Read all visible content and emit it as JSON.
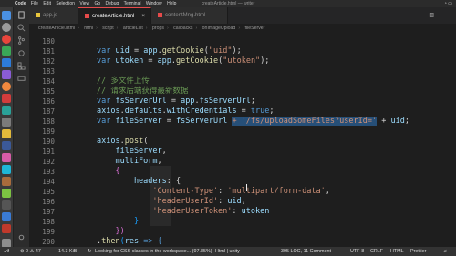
{
  "menubar": {
    "app_name": "Code",
    "items": [
      "File",
      "Edit",
      "Selection",
      "View",
      "Go",
      "Debug",
      "Terminal",
      "Window",
      "Help"
    ],
    "window_title": "createArticle.html — writer"
  },
  "tabs": [
    {
      "label": "app.js",
      "active": false
    },
    {
      "label": "createArticle.html",
      "active": true
    },
    {
      "label": "contentMng.html",
      "active": false
    }
  ],
  "breadcrumb": [
    "createArticle.html",
    "html",
    "script",
    "articleList",
    "props",
    "callbacks",
    "onImageUpload",
    "fileServer"
  ],
  "code_lines": [
    {
      "num": "180",
      "tokens": []
    },
    {
      "num": "181",
      "tokens": [
        {
          "t": "var ",
          "c": "t-kw"
        },
        {
          "t": "uid",
          "c": "t-var"
        },
        {
          "t": " = ",
          "c": "t-pl"
        },
        {
          "t": "app",
          "c": "t-var"
        },
        {
          "t": ".",
          "c": "t-pl"
        },
        {
          "t": "getCookie",
          "c": "t-fn"
        },
        {
          "t": "(",
          "c": "t-pl"
        },
        {
          "t": "\"uid\"",
          "c": "t-str"
        },
        {
          "t": ");",
          "c": "t-pl"
        }
      ]
    },
    {
      "num": "182",
      "tokens": [
        {
          "t": "var ",
          "c": "t-kw"
        },
        {
          "t": "utoken",
          "c": "t-var"
        },
        {
          "t": " = ",
          "c": "t-pl"
        },
        {
          "t": "app",
          "c": "t-var"
        },
        {
          "t": ".",
          "c": "t-pl"
        },
        {
          "t": "getCookie",
          "c": "t-fn"
        },
        {
          "t": "(",
          "c": "t-pl"
        },
        {
          "t": "\"utoken\"",
          "c": "t-str"
        },
        {
          "t": ");",
          "c": "t-pl"
        }
      ]
    },
    {
      "num": "183",
      "tokens": []
    },
    {
      "num": "184",
      "tokens": [
        {
          "t": "// 多文件上传",
          "c": "t-cm"
        }
      ]
    },
    {
      "num": "185",
      "tokens": [
        {
          "t": "// 请求后端获得最新数据",
          "c": "t-cm"
        }
      ]
    },
    {
      "num": "186",
      "tokens": [
        {
          "t": "var ",
          "c": "t-kw"
        },
        {
          "t": "fsServerUrl",
          "c": "t-var"
        },
        {
          "t": " = ",
          "c": "t-pl"
        },
        {
          "t": "app",
          "c": "t-var"
        },
        {
          "t": ".",
          "c": "t-pl"
        },
        {
          "t": "fsServerUrl",
          "c": "t-var"
        },
        {
          "t": ";",
          "c": "t-pl"
        }
      ]
    },
    {
      "num": "187",
      "tokens": [
        {
          "t": "axios",
          "c": "t-var"
        },
        {
          "t": ".",
          "c": "t-pl"
        },
        {
          "t": "defaults",
          "c": "t-var"
        },
        {
          "t": ".",
          "c": "t-pl"
        },
        {
          "t": "withCredentials",
          "c": "t-var"
        },
        {
          "t": " = ",
          "c": "t-pl"
        },
        {
          "t": "true",
          "c": "t-kw"
        },
        {
          "t": ";",
          "c": "t-pl"
        }
      ]
    },
    {
      "num": "188",
      "tokens": [
        {
          "t": "var ",
          "c": "t-kw"
        },
        {
          "t": "fileServer",
          "c": "t-var"
        },
        {
          "t": " = ",
          "c": "t-pl"
        },
        {
          "t": "fsServerUrl",
          "c": "t-var"
        },
        {
          "t": " ",
          "c": "t-pl"
        },
        {
          "t": "+ '/fs/uploadSomeFiles?userId='",
          "c": "t-str hl"
        },
        {
          "t": " + ",
          "c": "t-pl"
        },
        {
          "t": "uid",
          "c": "t-var"
        },
        {
          "t": ";",
          "c": "t-pl"
        }
      ]
    },
    {
      "num": "189",
      "tokens": []
    },
    {
      "num": "190",
      "tokens": [
        {
          "t": "axios",
          "c": "t-var"
        },
        {
          "t": ".",
          "c": "t-pl"
        },
        {
          "t": "post",
          "c": "t-fn"
        },
        {
          "t": "(",
          "c": "t-pl"
        }
      ]
    },
    {
      "num": "191",
      "tokens": [
        {
          "t": "    fileServer",
          "c": "t-var"
        },
        {
          "t": ",",
          "c": "t-pl"
        }
      ]
    },
    {
      "num": "192",
      "tokens": [
        {
          "t": "    multiForm",
          "c": "t-var"
        },
        {
          "t": ",",
          "c": "t-pl"
        }
      ]
    },
    {
      "num": "193",
      "tokens": [
        {
          "t": "    {",
          "c": "t-br1"
        }
      ]
    },
    {
      "num": "194",
      "tokens": [
        {
          "t": "        headers",
          "c": "t-var"
        },
        {
          "t": ": {",
          "c": "t-pl"
        }
      ]
    },
    {
      "num": "195",
      "tokens": [
        {
          "t": "            'Content-Type'",
          "c": "t-str"
        },
        {
          "t": ": ",
          "c": "t-pl"
        },
        {
          "t": "'multipart/form-data'",
          "c": "t-str"
        },
        {
          "t": ",",
          "c": "t-pl"
        }
      ]
    },
    {
      "num": "196",
      "tokens": [
        {
          "t": "            'headerUserId'",
          "c": "t-str"
        },
        {
          "t": ": ",
          "c": "t-pl"
        },
        {
          "t": "uid",
          "c": "t-var"
        },
        {
          "t": ",",
          "c": "t-pl"
        }
      ]
    },
    {
      "num": "197",
      "tokens": [
        {
          "t": "            'headerUserToken'",
          "c": "t-str"
        },
        {
          "t": ": ",
          "c": "t-pl"
        },
        {
          "t": "utoken",
          "c": "t-var"
        }
      ]
    },
    {
      "num": "198",
      "tokens": [
        {
          "t": "        }",
          "c": "t-br2"
        }
      ]
    },
    {
      "num": "199",
      "tokens": [
        {
          "t": "    })",
          "c": "t-br1"
        }
      ]
    },
    {
      "num": "200",
      "tokens": [
        {
          "t": ".",
          "c": "t-pl"
        },
        {
          "t": "then",
          "c": "t-fn"
        },
        {
          "t": "(",
          "c": "t-br2"
        },
        {
          "t": "res",
          "c": "t-var"
        },
        {
          "t": " => {",
          "c": "t-kw"
        }
      ]
    }
  ],
  "statusbar": {
    "problems": "⊗ 0  ⚠ 47",
    "filesize": "14.3 KiB",
    "tip": "Looking for CSS classes in the workspace... (97.85%)",
    "language_mode": "Html | unity",
    "position": "395 LOC, 11 Comment",
    "encoding": "UTF-8",
    "eol": "CRLF",
    "language": "HTML",
    "formatter": "Prettier"
  },
  "colors": {
    "accent_tab": "#e64a4a",
    "comment": "#6a9955",
    "string": "#ce9178",
    "keyword": "#569cd6",
    "variable": "#9cdcfe",
    "function": "#dcdcaa"
  }
}
